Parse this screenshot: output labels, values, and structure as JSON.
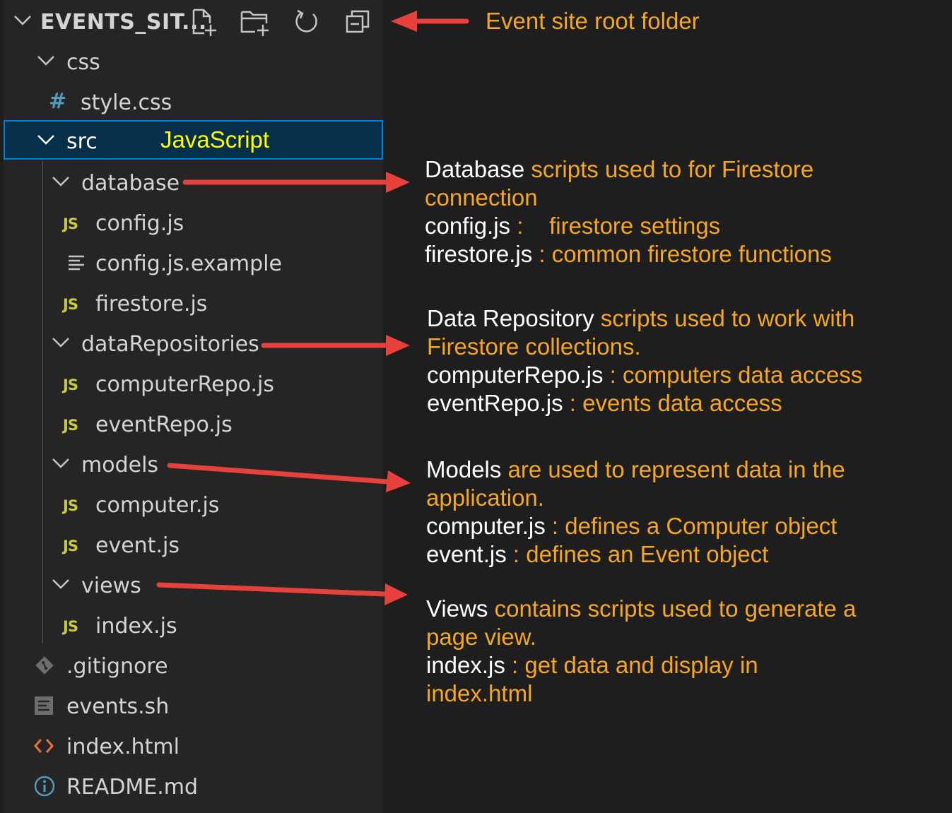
{
  "explorer": {
    "root_label": "EVENTS_SIT...",
    "tree": {
      "css": "css",
      "style_css": "style.css",
      "style_css_badge": "#",
      "src": "src",
      "src_note": "JavaScript",
      "database": "database",
      "config_js": "config.js",
      "config_js_example": "config.js.example",
      "firestore_js": "firestore.js",
      "dataRepositories": "dataRepositories",
      "computerRepo_js": "computerRepo.js",
      "eventRepo_js": "eventRepo.js",
      "models": "models",
      "computer_js": "computer.js",
      "event_js": "event.js",
      "views": "views",
      "index_js": "index.js",
      "gitignore": ".gitignore",
      "events_sh": "events.sh",
      "index_html": "index.html",
      "readme_md": "README.md",
      "js_badge": "JS"
    }
  },
  "annotations": {
    "root": "Event site root folder",
    "database": {
      "l1_white": "Database",
      "l1_orange": " scripts used to for Firestore",
      "l2_orange": "connection",
      "l3_white": "config.js",
      "l3_orange": " :    firestore settings",
      "l4_white": "firestore.js",
      "l4_orange": " : common firestore functions"
    },
    "repositories": {
      "l1_white": "Data Repository",
      "l1_orange": " scripts used to work with",
      "l2_orange": "Firestore collections.",
      "l3_white": "computerRepo.js",
      "l3_orange": " : computers data access",
      "l4_white": "eventRepo.js",
      "l4_orange": " : events data access"
    },
    "models": {
      "l1_white": "Models",
      "l1_orange": " are used to represent data in the",
      "l2_orange": "application.",
      "l3_white": "computer.js",
      "l3_orange": " : defines a Computer object",
      "l4_white": "event.js",
      "l4_orange": " : defines an Event object"
    },
    "views": {
      "l1_white": "Views",
      "l1_orange": " contains scripts used to generate a",
      "l2_orange": "page view.",
      "l3_white": "index.js",
      "l3_orange": " : get data and display in",
      "l4_orange": "index.html"
    }
  },
  "colors": {
    "annotation_orange": "#f5a623",
    "arrow_red": "#e8413c",
    "selection_border": "#007fd4",
    "js_yellow": "#cbcb41"
  }
}
